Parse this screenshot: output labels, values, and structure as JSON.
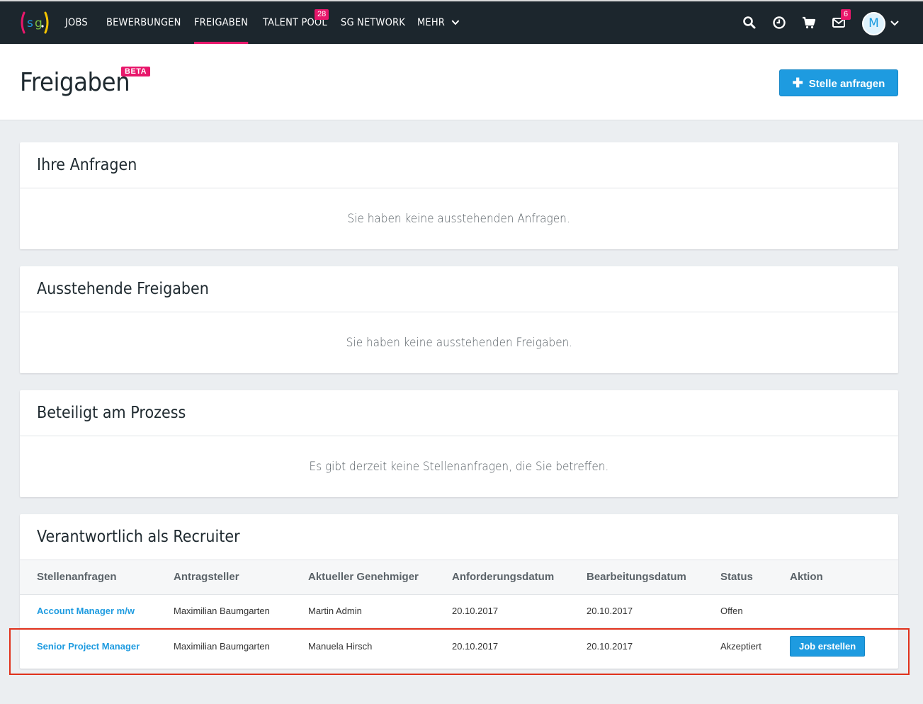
{
  "nav": {
    "items": [
      {
        "label": "JOBS"
      },
      {
        "label": "BEWERBUNGEN"
      },
      {
        "label": "FREIGABEN"
      },
      {
        "label": "TALENT POOL",
        "badge": "28"
      },
      {
        "label": "SG NETWORK"
      },
      {
        "label": "MEHR"
      }
    ],
    "messages_badge": "6",
    "avatar_initial": "M",
    "icons": [
      "search-icon",
      "clock-icon",
      "cart-icon",
      "mail-icon",
      "chevron-down-icon"
    ]
  },
  "header": {
    "title": "Freigaben",
    "beta": "BETA",
    "request_button": "Stelle anfragen"
  },
  "sections": [
    {
      "title": "Ihre Anfragen",
      "empty": "Sie haben keine ausstehenden Anfragen."
    },
    {
      "title": "Ausstehende Freigaben",
      "empty": "Sie haben keine ausstehenden Freigaben."
    },
    {
      "title": "Beteiligt am Prozess",
      "empty": "Es gibt derzeit keine Stellenanfragen, die Sie betreffen."
    }
  ],
  "recruiter": {
    "title": "Verantwortlich als Recruiter",
    "columns": [
      "Stellenanfragen",
      "Antragsteller",
      "Aktueller Genehmiger",
      "Anforderungsdatum",
      "Bearbeitungsdatum",
      "Status",
      "Aktion"
    ],
    "rows": [
      {
        "job": "Account Manager m/w",
        "applicant": "Maximilian Baumgarten",
        "approver": "Martin Admin",
        "requested": "20.10.2017",
        "processed": "20.10.2017",
        "status": "Offen",
        "action": ""
      },
      {
        "job": "Senior Project Manager",
        "applicant": "Maximilian Baumgarten",
        "approver": "Manuela Hirsch",
        "requested": "20.10.2017",
        "processed": "20.10.2017",
        "status": "Akzeptiert",
        "action": "Job erstellen"
      }
    ]
  },
  "colors": {
    "brand_pink": "#e8176b",
    "primary_blue": "#1e9be0",
    "topbar": "#1c262d",
    "highlight": "#e0311b"
  }
}
